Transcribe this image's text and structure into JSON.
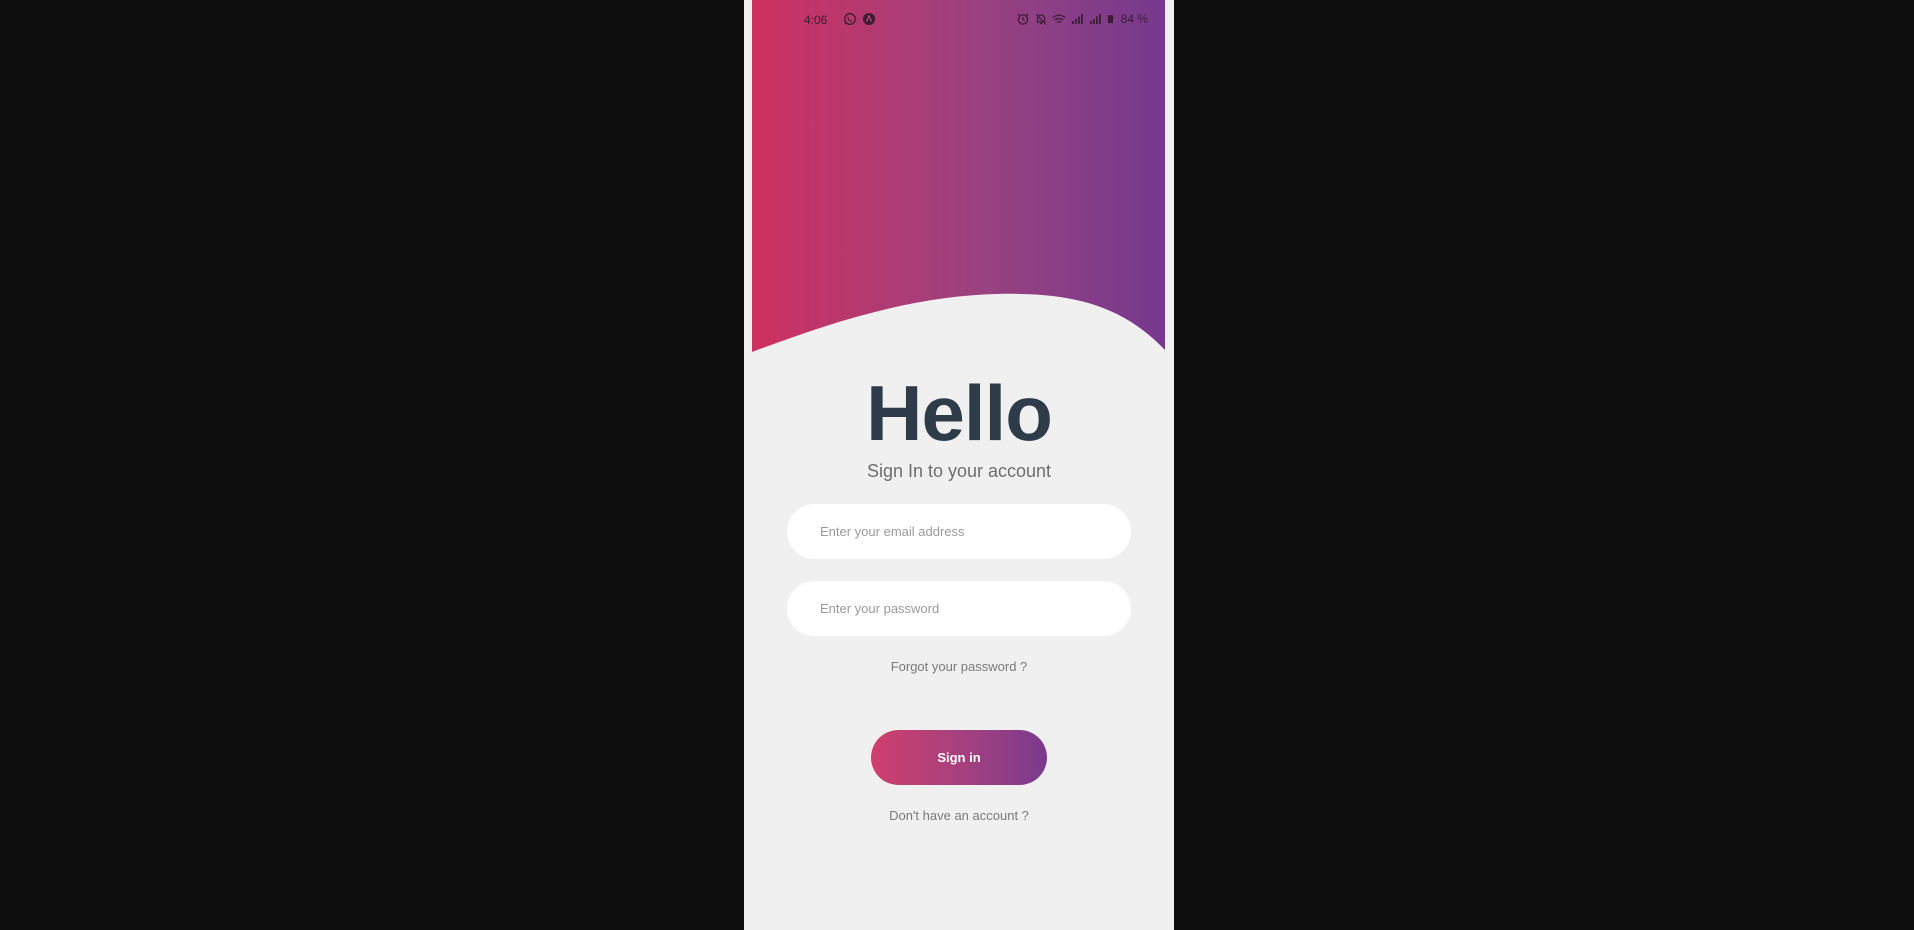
{
  "status_bar": {
    "time": "4:06",
    "left_icons": [
      "whatsapp-icon",
      "app-notification-icon"
    ],
    "right_icons": [
      "alarm-icon",
      "mute-icon",
      "wifi-icon",
      "signal-icon",
      "signal-icon",
      "battery-icon"
    ],
    "battery": "84 %"
  },
  "header": {
    "gradient_start": "#cf3060",
    "gradient_end": "#76398e"
  },
  "login": {
    "title": "Hello",
    "subtitle": "Sign In to your account",
    "email_placeholder": "Enter your email address",
    "password_placeholder": "Enter your password",
    "forgot_label": "Forgot your password ?",
    "signin_label": "Sign in",
    "signup_label": "Don't have an account ?"
  }
}
